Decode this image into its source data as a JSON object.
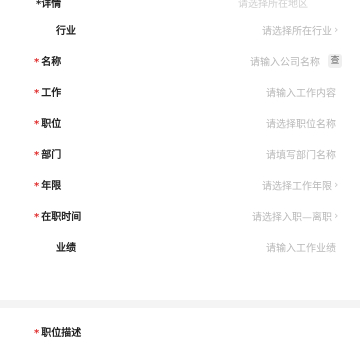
{
  "top": {
    "left_text": "*详情",
    "right_text": "请选择所在地区"
  },
  "rows": [
    {
      "label": "行业",
      "required": false,
      "indent": true,
      "value": "请选择所在行业",
      "arrow": true
    },
    {
      "label": "名称",
      "required": true,
      "indent": false,
      "value": "请输入公司名称",
      "badge": "查",
      "arrow": false
    },
    {
      "label": "工作",
      "required": true,
      "indent": false,
      "value": "请输入工作内容",
      "arrow": false
    },
    {
      "label": "职位",
      "required": true,
      "indent": false,
      "value": "请选择职位名称",
      "arrow": false
    },
    {
      "label": "部门",
      "required": true,
      "indent": false,
      "value": "请填写部门名称",
      "arrow": false
    },
    {
      "label": "年限",
      "required": true,
      "indent": false,
      "value": "请选择工作年限",
      "arrow": true
    },
    {
      "label": "在职时间",
      "required": true,
      "indent": false,
      "value": "请选择入职—离职",
      "arrow": true
    },
    {
      "label": "业绩",
      "required": false,
      "indent": true,
      "value": "请输入工作业绩",
      "arrow": false
    }
  ],
  "bottom": {
    "label": "职位描述",
    "required": true
  }
}
